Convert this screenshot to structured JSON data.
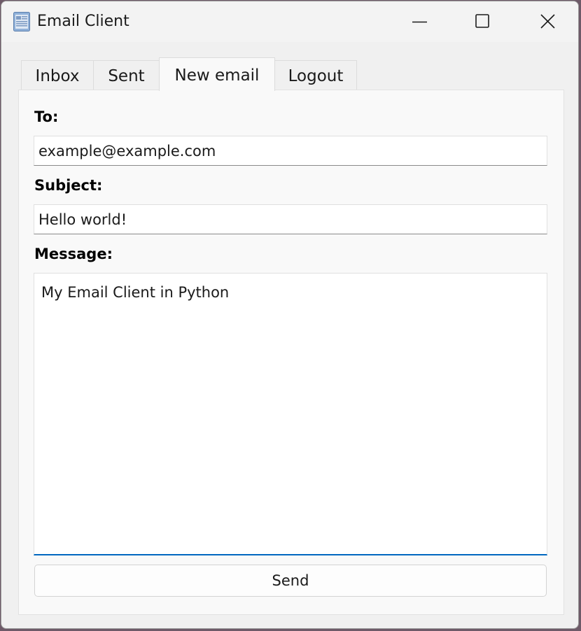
{
  "window": {
    "title": "Email Client",
    "app_icon": "document-icon",
    "controls": {
      "minimize": "minimize-icon",
      "maximize": "maximize-icon",
      "close": "close-icon"
    }
  },
  "tabs": [
    {
      "label": "Inbox",
      "active": false
    },
    {
      "label": "Sent",
      "active": false
    },
    {
      "label": "New email",
      "active": true
    },
    {
      "label": "Logout",
      "active": false
    }
  ],
  "form": {
    "to_label": "To:",
    "to_value": "example@example.com",
    "subject_label": "Subject:",
    "subject_value": "Hello world!",
    "message_label": "Message:",
    "message_value": "My Email Client in Python",
    "send_label": "Send"
  },
  "colors": {
    "accent": "#0067c0",
    "window_bg": "#f0f0f0",
    "panel_bg": "#f9f9f9"
  }
}
